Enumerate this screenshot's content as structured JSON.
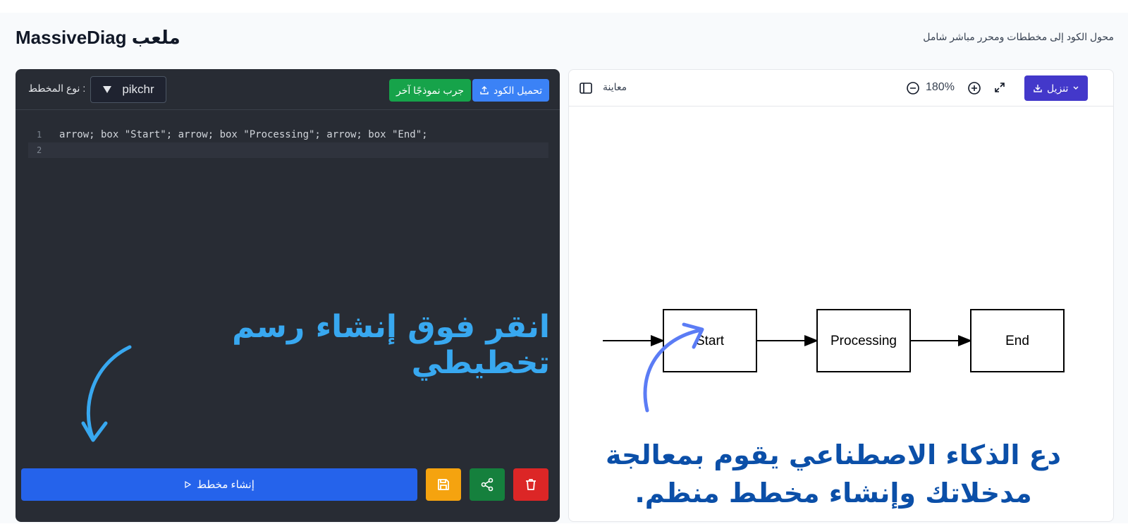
{
  "header": {
    "title": "MassiveDiag ملعب",
    "subtitle": "محول الكود إلى مخططات ومحرر مباشر شامل"
  },
  "editor": {
    "upload_label": "تحميل الكود",
    "sample_label": "جرب نموذجًا آخر",
    "diagram_type_label": ": نوع المخطط",
    "diagram_type_value": "pikchr",
    "code_lines": [
      {
        "num": "1",
        "text": "arrow; box \"Start\"; arrow; box \"Processing\"; arrow; box \"End\";"
      },
      {
        "num": "2",
        "text": ""
      }
    ],
    "generate_label": "إنشاء مخطط",
    "icons": {
      "save": "save-icon",
      "share": "share-icon",
      "delete": "trash-icon"
    }
  },
  "preview": {
    "download_label": "تنزيل",
    "zoom_level": "180%",
    "label": "معاينة",
    "diagram": {
      "boxes": [
        "Start",
        "Processing",
        "End"
      ]
    }
  },
  "annotations": {
    "left": "انقر فوق إنشاء رسم تخطيطي",
    "right": "دع الذكاء الاصطناعي يقوم بمعالجة مدخلاتك وإنشاء مخطط منظم."
  },
  "colors": {
    "upload": "#3b82f6",
    "sample": "#16a34a",
    "generate": "#2563eb",
    "save": "#f5a30f",
    "share": "#15803d",
    "delete": "#dc2626",
    "download": "#4338ca",
    "annot_left": "#38a8f0",
    "annot_right": "#0b4fa8"
  }
}
